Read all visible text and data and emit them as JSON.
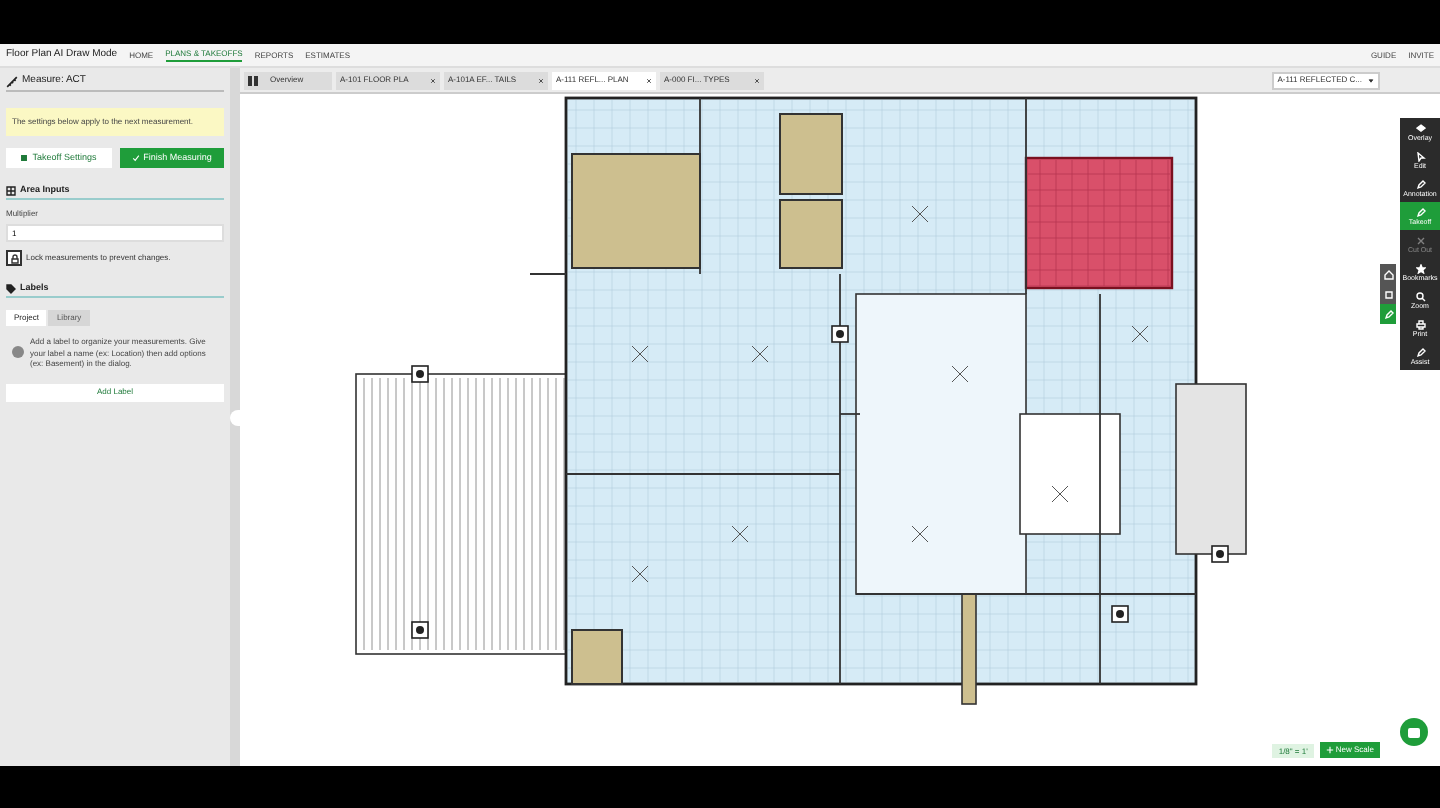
{
  "app_bar": {
    "title": "Floor Plan AI Draw Mode",
    "nav": [
      {
        "label": "HOME",
        "selected": false
      },
      {
        "label": "PLANS & TAKEOFFS",
        "selected": true
      },
      {
        "label": "REPORTS",
        "selected": false
      },
      {
        "label": "ESTIMATES",
        "selected": false
      }
    ],
    "actions": [
      "GUIDE",
      "INVITE"
    ]
  },
  "panel": {
    "title": "Measure: ACT",
    "notice": "The settings below apply to the next measurement.",
    "buttons": [
      {
        "label": "Takeoff Settings",
        "kind": "secondary"
      },
      {
        "label": "Finish Measuring",
        "kind": "primary"
      }
    ],
    "area_inputs": {
      "heading": "Area Inputs",
      "multiplier_label": "Multiplier",
      "multiplier_value": "1",
      "lock_label": "Lock measurements to prevent changes."
    },
    "labels": {
      "heading": "Labels",
      "tabs": [
        {
          "label": "Project",
          "selected": true
        },
        {
          "label": "Library",
          "selected": false
        }
      ],
      "hint": "Add a label to organize your measurements. Give your label a name (ex: Location) then add options (ex: Basement) in the dialog.",
      "add_button": "Add Label"
    }
  },
  "sheet_tabs": [
    {
      "label": "Overview",
      "kind": "overview",
      "selected": false
    },
    {
      "label": "A-101 FLOOR PLA",
      "kind": "sheet",
      "selected": false
    },
    {
      "label": "A-101A EF... TAILS",
      "kind": "sheet",
      "selected": false
    },
    {
      "label": "A-111 REFL... PLAN",
      "kind": "sheet",
      "selected": true
    },
    {
      "label": "A-000 FI... TYPES",
      "kind": "sheet",
      "selected": false
    }
  ],
  "sheet_select": "A-111 REFLECTED C...",
  "toolbar": [
    {
      "label": "Overlay",
      "selected": false,
      "disabled": false
    },
    {
      "label": "Edit",
      "selected": false,
      "disabled": false
    },
    {
      "label": "Annotation",
      "selected": false,
      "disabled": false
    },
    {
      "label": "Takeoff",
      "selected": true,
      "disabled": false
    },
    {
      "label": "Cut Out",
      "selected": false,
      "disabled": true
    },
    {
      "label": "Bookmarks",
      "selected": false,
      "disabled": false
    },
    {
      "label": "Zoom",
      "selected": false,
      "disabled": false
    },
    {
      "label": "Print",
      "selected": false,
      "disabled": false
    },
    {
      "label": "Assist",
      "selected": false,
      "disabled": false
    }
  ],
  "side_tools": [
    {
      "selected": false
    },
    {
      "selected": false
    },
    {
      "selected": true
    }
  ],
  "scale": {
    "label": "1/8\" = 1'",
    "button": "New Scale"
  }
}
